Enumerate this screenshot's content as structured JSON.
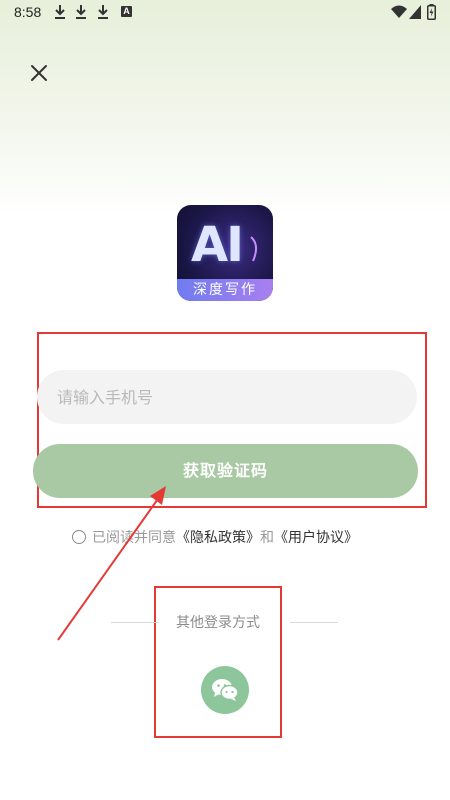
{
  "status_bar": {
    "time": "8:58",
    "icons": [
      "download-icon",
      "download-icon",
      "download-icon",
      "a-notification-icon",
      "wifi-icon",
      "signal-icon",
      "battery-icon"
    ],
    "a_icon_text": "A"
  },
  "app": {
    "logo_text": "AI",
    "logo_banner": "深度写作"
  },
  "form": {
    "phone_placeholder": "请输入手机号",
    "phone_value": "",
    "get_code_label": "获取验证码"
  },
  "agreement": {
    "prefix": "已阅读并同意",
    "privacy_link": "《隐私政策》",
    "and": "和",
    "user_link": "《用户协议》",
    "checked": false
  },
  "other_login": {
    "label": "其他登录方式",
    "methods": [
      "wechat-icon"
    ]
  },
  "colors": {
    "button_green": "#a9c8a4",
    "wechat_green": "#8dc69a",
    "annotation_red": "#e53935"
  }
}
